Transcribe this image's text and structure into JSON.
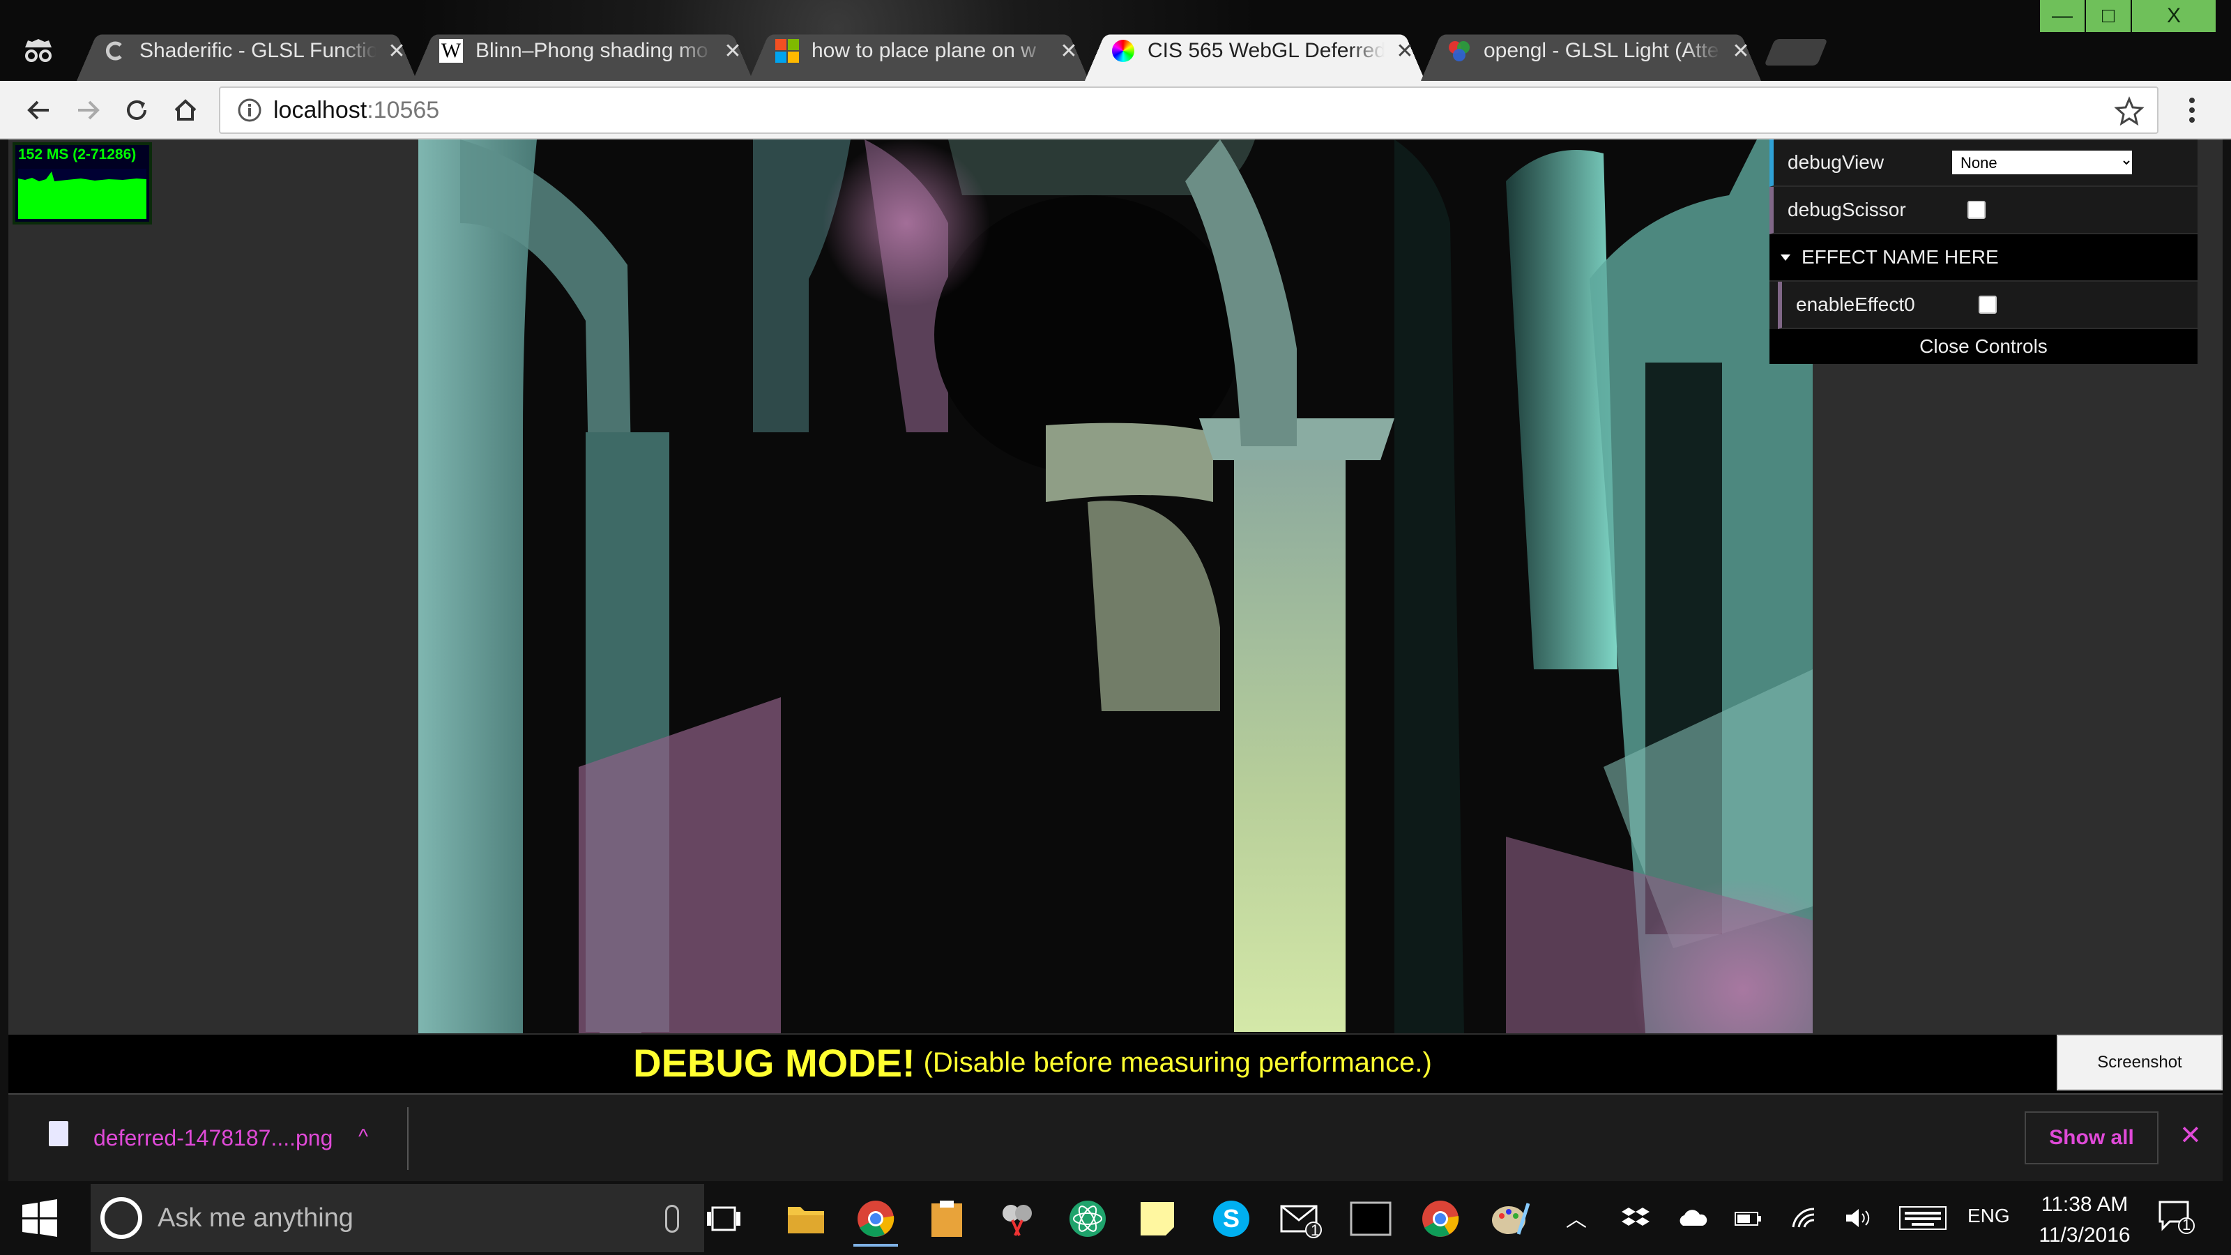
{
  "browser": {
    "tabs": [
      {
        "title": "Shaderific - GLSL Functio",
        "favicon": "shaderific-icon",
        "active": false
      },
      {
        "title": "Blinn–Phong shading mo",
        "favicon": "wikipedia-icon",
        "active": false
      },
      {
        "title": "how to place plane on w",
        "favicon": "microsoft-icon",
        "active": false
      },
      {
        "title": "CIS 565 WebGL Deferred",
        "favicon": "color-wheel-icon",
        "active": true
      },
      {
        "title": "opengl - GLSL Light (Atte",
        "favicon": "opengl-icon",
        "active": false
      }
    ],
    "tab_close_glyph": "✕",
    "address": {
      "host": "localhost",
      "port": ":10565"
    },
    "window_buttons": {
      "minimize": "—",
      "maximize": "□",
      "close": "X"
    }
  },
  "stats": {
    "text": "152 MS (2-71286)"
  },
  "gui": {
    "debugView_label": "debugView",
    "debugView_value": "None",
    "debugScissor_label": "debugScissor",
    "folder_title": "EFFECT NAME HERE",
    "enableEffect0_label": "enableEffect0",
    "close_label": "Close Controls"
  },
  "debug_banner": {
    "title": "DEBUG MODE!",
    "subtitle": "(Disable before measuring performance.)"
  },
  "screenshot_button": "Screenshot",
  "downloads": {
    "file": "deferred-1478187....png",
    "chevron": "^",
    "show_all": "Show all",
    "close": "✕"
  },
  "taskbar": {
    "search_placeholder": "Ask me anything",
    "tray_lang": "ENG",
    "time": "11:38 AM",
    "date": "11/3/2016",
    "mail_badge": "1",
    "notif_badge": "1"
  },
  "colors": {
    "accent_green": "#00ff00",
    "debug_yellow": "#ffff30",
    "download_pink": "#e04ad8",
    "gui_blue": "#2fa1d6"
  }
}
